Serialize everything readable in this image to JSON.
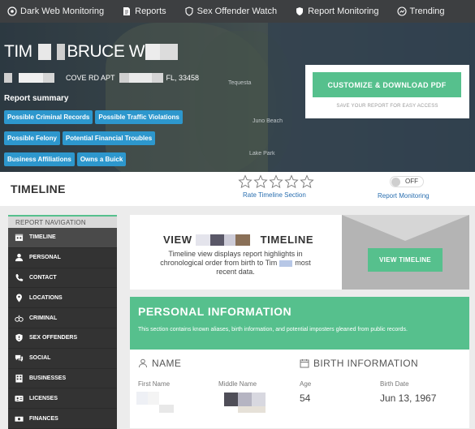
{
  "topnav": {
    "items": [
      {
        "label": "Dark Web Monitoring",
        "icon": "eye-icon"
      },
      {
        "label": "Reports",
        "icon": "document-icon"
      },
      {
        "label": "Sex Offender Watch",
        "icon": "shield-icon"
      },
      {
        "label": "Report Monitoring",
        "icon": "shield-icon"
      },
      {
        "label": "Trending",
        "icon": "trending-icon"
      }
    ]
  },
  "hero": {
    "name_first": "TIM",
    "name_middle": "BRUCE W",
    "address": "COVE RD APT",
    "address_tail": "FL, 33458",
    "summary_title": "Report summary",
    "tags": [
      "Possible Criminal Records",
      "Possible Traffic Violations",
      "Possible Felony",
      "Potential Financial Troubles",
      "Business Affiliations",
      "Owns a Buick"
    ],
    "map_labels": [
      "Tequesta",
      "Juno Beach",
      "Lake Park"
    ],
    "customize_button": "CUSTOMIZE & DOWNLOAD PDF",
    "customize_sub": "SAVE YOUR REPORT FOR EASY ACCESS"
  },
  "timeline_header": {
    "title": "TIMELINE",
    "rating_link": "Rate Timeline Section",
    "toggle_label": "OFF",
    "monitoring_link": "Report Monitoring"
  },
  "sidebar": {
    "heading": "REPORT NAVIGATION",
    "items": [
      {
        "label": "TIMELINE",
        "icon": "calendar-icon"
      },
      {
        "label": "PERSONAL",
        "icon": "person-icon"
      },
      {
        "label": "CONTACT",
        "icon": "phone-icon"
      },
      {
        "label": "LOCATIONS",
        "icon": "map-pin-icon"
      },
      {
        "label": "CRIMINAL",
        "icon": "handcuffs-icon"
      },
      {
        "label": "SEX OFFENDERS",
        "icon": "alert-shield-icon"
      },
      {
        "label": "SOCIAL",
        "icon": "chat-icon"
      },
      {
        "label": "BUSINESSES",
        "icon": "building-icon"
      },
      {
        "label": "LICENSES",
        "icon": "id-card-icon"
      },
      {
        "label": "FINANCES",
        "icon": "money-icon"
      }
    ]
  },
  "view_timeline": {
    "title_start": "VIEW",
    "title_end": "TIMELINE",
    "description_1": "Timeline view displays report highlights in",
    "description_2": "chronological order from birth to Tim",
    "description_3": "most",
    "description_4": "recent data.",
    "button": "VIEW TIMELINE"
  },
  "personal_info": {
    "title": "PERSONAL INFORMATION",
    "description": "This section contains known aliases, birth information, and potential imposters gleaned from public records.",
    "name_section": "NAME",
    "first_name_label": "First Name",
    "middle_name_label": "Middle Name",
    "birth_section": "BIRTH INFORMATION",
    "age_label": "Age",
    "age_value": "54",
    "birth_date_label": "Birth Date",
    "birth_date_value": "Jun 13, 1967"
  },
  "colors": {
    "accent_green": "#56c08d",
    "tag_blue": "#2d97cd",
    "nav_dark": "#3d3f41",
    "link_blue": "#2a6fb0"
  }
}
